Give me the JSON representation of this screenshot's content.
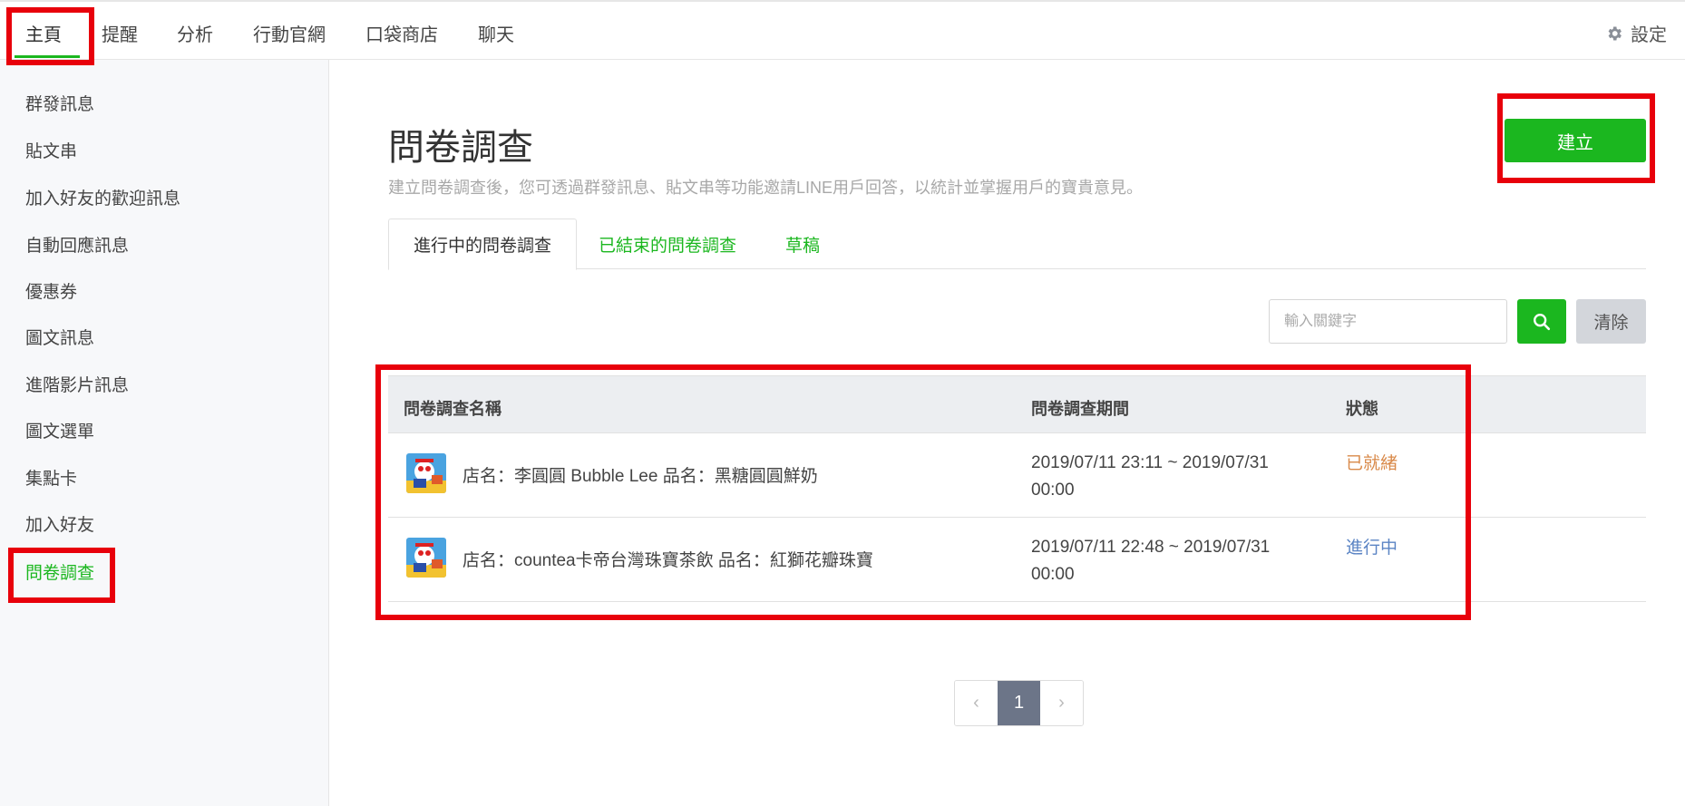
{
  "topnav": {
    "tabs": [
      "主頁",
      "提醒",
      "分析",
      "行動官網",
      "口袋商店",
      "聊天"
    ],
    "settings_label": "設定"
  },
  "sidebar": {
    "items": [
      "群發訊息",
      "貼文串",
      "加入好友的歡迎訊息",
      "自動回應訊息",
      "優惠券",
      "圖文訊息",
      "進階影片訊息",
      "圖文選單",
      "集點卡",
      "加入好友",
      "問卷調查"
    ],
    "active_index": 10
  },
  "main": {
    "title": "問卷調查",
    "description": "建立問卷調查後，您可透過群發訊息、貼文串等功能邀請LINE用戶回答，以統計並掌握用戶的寶貴意見。",
    "create_label": "建立",
    "tabs": [
      "進行中的問卷調查",
      "已結束的問卷調查",
      "草稿"
    ],
    "search_placeholder": "輸入關鍵字",
    "clear_label": "清除"
  },
  "table": {
    "headers": [
      "問卷調查名稱",
      "問卷調查期間",
      "狀態"
    ],
    "rows": [
      {
        "name": "店名：李圓圓 Bubble Lee 品名：黑糖圓圓鮮奶",
        "period_line1": "2019/07/11 23:11 ~ 2019/07/31",
        "period_line2": "00:00",
        "status": "已就緒",
        "status_color": "#d98a4a"
      },
      {
        "name": "店名：countea卡帝台灣珠寶茶飲 品名：紅獅花瓣珠寶",
        "period_line1": "2019/07/11 22:48 ~ 2019/07/31",
        "period_line2": "00:00",
        "status": "進行中",
        "status_color": "#5b84c4"
      }
    ]
  },
  "pagination": {
    "prev": "‹",
    "current": "1",
    "next": "›"
  },
  "colors": {
    "accent": "#1bb71f",
    "highlight": "#e8000b"
  }
}
